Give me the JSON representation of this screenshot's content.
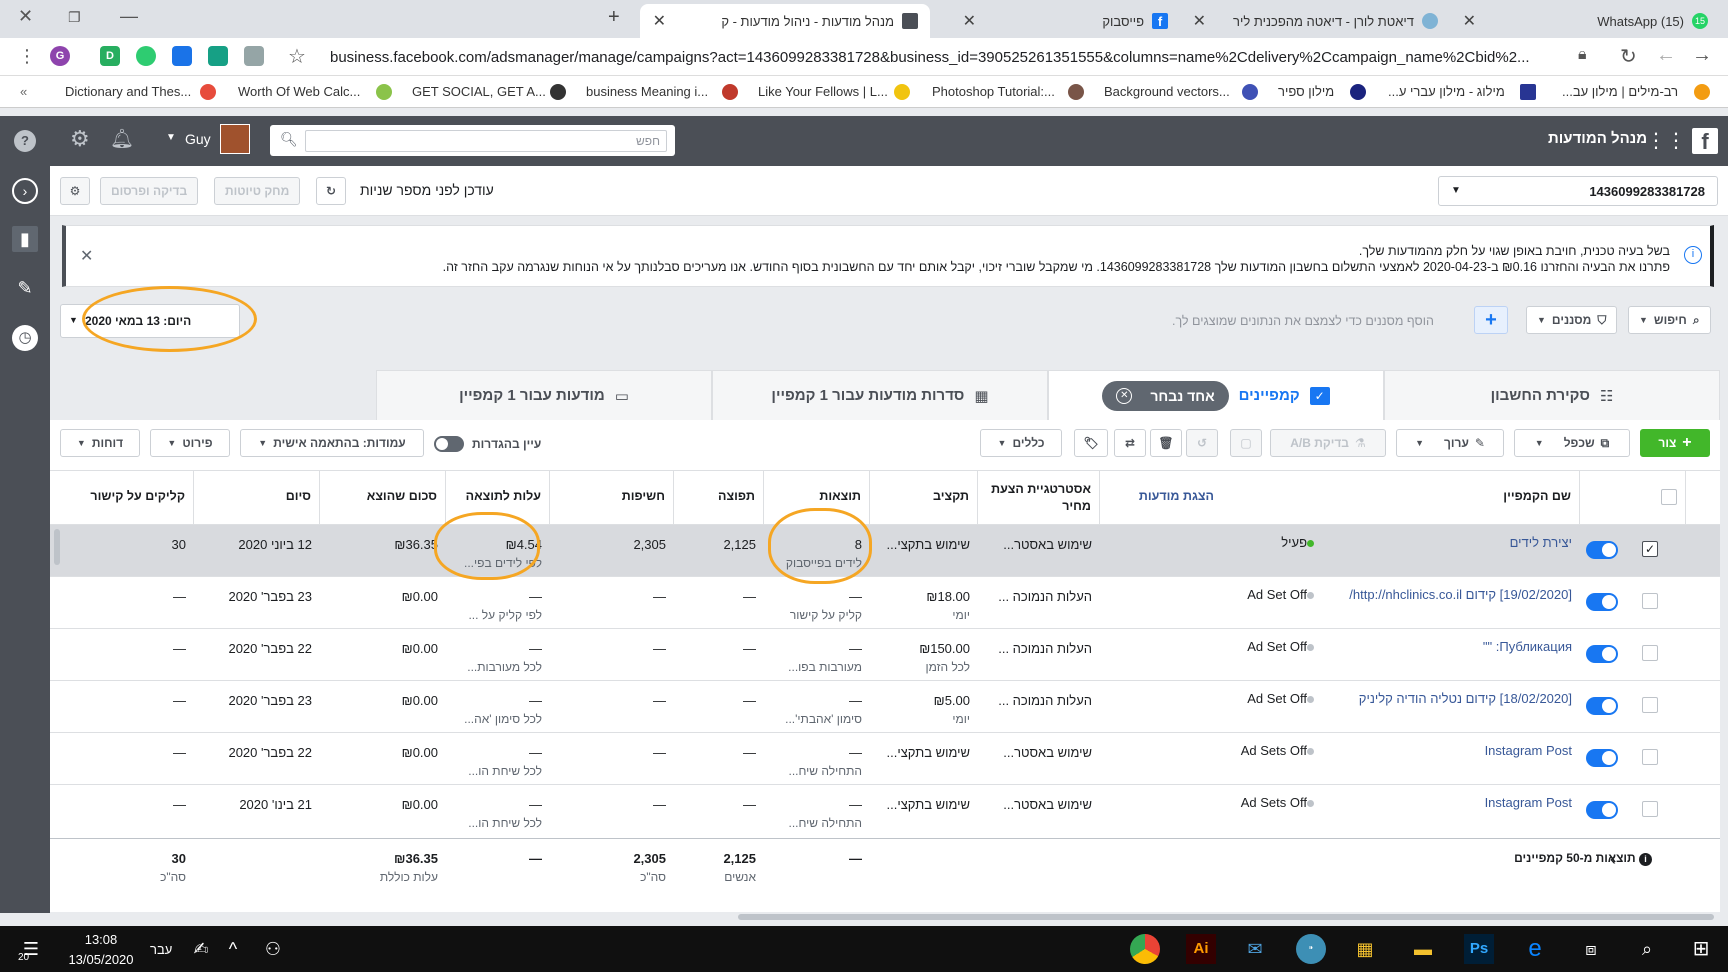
{
  "browser": {
    "tabs": [
      {
        "title": "(15) WhatsApp",
        "badge": "15"
      },
      {
        "title": "דיאטת לורן - דיאטה מהפכנית ליר"
      },
      {
        "title": "פייסבוק"
      },
      {
        "title": "מנהל מודעות - ניהול מודעות - ק"
      }
    ],
    "url": "business.facebook.com/adsmanager/manage/campaigns?act=1436099283381728&business_id=390525261351555&columns=name%2Cdelivery%2Ccampaign_name%2Cbid%2...",
    "bookmarks": [
      "Dictionary and Thes...",
      "Worth Of Web Calc...",
      "GET SOCIAL, GET A...",
      "business Meaning i...",
      "Like Your Fellows | L...",
      "Photoshop Tutorial:...",
      "Background vectors...",
      "מילון ספיר",
      "מילוג - מילון עברי ע...",
      "רב-מילים | מילון עב..."
    ],
    "profile_letter": "G"
  },
  "fb": {
    "app_title": "מנהל המודעות",
    "search_placeholder": "חפש",
    "user_name": "Guy",
    "account_id": "1436099283381728",
    "updated_text": "עודכן לפני מספר שניות",
    "discard_label": "מחק טיוטות",
    "review_label": "בדיקה ופרסום",
    "notice_line1": "בשל בעיה טכנית, חויבת באופן שגוי על חלק מהמודעות שלך.",
    "notice_line2": "פתרנו את הבעיה והחזרנו ‎₪0.16‎ ב-2020-04-23 לאמצעי התשלום בחשבון המודעות שלך 1436099283381728. מי שמקבל שוברי זיכוי, יקבל אותם יחד עם החשבונית בסוף החודש. אנו מעריכים סבלנותך על אי הנוחות שנגרמה עקב החזר זה.",
    "search_btn": "חיפוש",
    "filters_btn": "מסננים",
    "filter_hint": "הוסף מסננים כדי לצמצם את הנתונים שמוצגים לך.",
    "date_label": "היום: 13 במאי 2020",
    "tab_overview": "סקירת החשבון",
    "tab_campaigns": "קמפיינים",
    "chip_selected": "אחד נבחר",
    "tab_adsets": "סדרות מודעות עבור 1 קמפיין",
    "tab_ads": "מודעות עבור 1 קמפיין",
    "create_btn": "צור",
    "duplicate_btn": "שכפל",
    "edit_btn": "ערוך",
    "ab_btn": "בדיקת A/B",
    "rules_btn": "כללים",
    "view_settings": "עיין בהגדרות",
    "columns_btn": "עמודות: בהתאמה אישית",
    "breakdown_btn": "פירוט",
    "reports_btn": "דוחות",
    "columns": [
      "שם הקמפיין",
      "הצגת מודעות",
      "אסטרטגיית הצעת מחיר",
      "תקציב",
      "תוצאות",
      "תפוצה",
      "חשיפות",
      "עלות לתוצאה",
      "סכום שהוצא",
      "סיום",
      "קליקים על קישור"
    ],
    "rows": [
      {
        "name": "יצירת לידים",
        "delivery": "פעיל",
        "active": true,
        "bid": "שימוש באסטר...",
        "budget": "שימוש בתקצי...",
        "budget_sub": "",
        "results": "8",
        "results_sub": "לידים בפייסבוק",
        "reach": "2,125",
        "impr": "2,305",
        "cpr": "₪4.54",
        "cpr_sub": "לפי לידים בפי...",
        "spent": "₪36.35",
        "end": "12 ביוני 2020",
        "clicks": "30"
      },
      {
        "name": "[19/02/2020] קידום http://nhclinics.co.il/",
        "delivery": "Ad Set Off",
        "active": false,
        "bid": "העלות הנמוכה ...",
        "budget": "₪18.00",
        "budget_sub": "יומי",
        "results": "—",
        "results_sub": "קליק על קישור",
        "reach": "—",
        "impr": "—",
        "cpr": "—",
        "cpr_sub": "לפי קליק על ...",
        "spent": "₪0.00",
        "end": "23 בפבר' 2020",
        "clicks": "—"
      },
      {
        "name": "Публикация: \"\"",
        "delivery": "Ad Set Off",
        "active": false,
        "bid": "העלות הנמוכה ...",
        "budget": "₪150.00",
        "budget_sub": "לכל הזמן",
        "results": "—",
        "results_sub": "מעורבות בפו...",
        "reach": "—",
        "impr": "—",
        "cpr": "—",
        "cpr_sub": "לכל מעורבות...",
        "spent": "₪0.00",
        "end": "22 בפבר' 2020",
        "clicks": "—"
      },
      {
        "name": "[18/02/2020] קידום נטליה הודיה קליניק",
        "delivery": "Ad Set Off",
        "active": false,
        "bid": "העלות הנמוכה ...",
        "budget": "₪5.00",
        "budget_sub": "יומי",
        "results": "—",
        "results_sub": "סימון 'אהבתי'...",
        "reach": "—",
        "impr": "—",
        "cpr": "—",
        "cpr_sub": "לכל סימון 'אה...",
        "spent": "₪0.00",
        "end": "23 בפבר' 2020",
        "clicks": "—"
      },
      {
        "name": "Instagram Post",
        "delivery": "Ad Sets Off",
        "active": false,
        "bid": "שימוש באסטר...",
        "budget": "שימוש בתקצי...",
        "budget_sub": "",
        "results": "—",
        "results_sub": "התחילה שיח...",
        "reach": "—",
        "impr": "—",
        "cpr": "—",
        "cpr_sub": "לכל שיחת הו...",
        "spent": "₪0.00",
        "end": "22 בפבר' 2020",
        "clicks": "—"
      },
      {
        "name": "Instagram Post",
        "delivery": "Ad Sets Off",
        "active": false,
        "bid": "שימוש באסטר...",
        "budget": "שימוש בתקצי...",
        "budget_sub": "",
        "results": "—",
        "results_sub": "התחילה שיח...",
        "reach": "—",
        "impr": "—",
        "cpr": "—",
        "cpr_sub": "לכל שיחת הו...",
        "spent": "₪0.00",
        "end": "21 בינו' 2020",
        "clicks": "—"
      }
    ],
    "totals": {
      "label": "תוצאות מ-50 קמפיינים",
      "results": "—",
      "reach": "2,125",
      "reach_sub": "אנשים",
      "impr": "2,305",
      "impr_sub": "סה\"כ",
      "cpr": "—",
      "spent": "₪36.35",
      "spent_sub": "עלות כוללת",
      "clicks": "30",
      "clicks_sub": "סה\"כ"
    }
  },
  "taskbar": {
    "time": "13:08",
    "date": "13/05/2020",
    "lang": "עבר",
    "notif": "20"
  }
}
